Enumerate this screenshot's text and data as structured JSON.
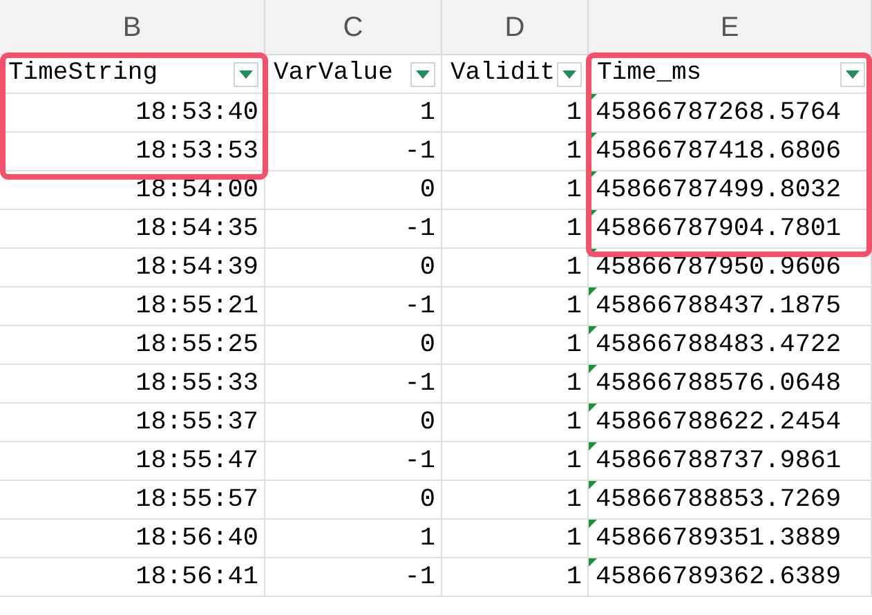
{
  "column_letters": [
    "B",
    "C",
    "D",
    "E"
  ],
  "header": [
    {
      "label": "TimeString",
      "boxed": true
    },
    {
      "label": "VarValue",
      "boxed": false
    },
    {
      "label": "Validit",
      "boxed": false
    },
    {
      "label": "Time_ms",
      "boxed": true
    }
  ],
  "rows": [
    {
      "time": "18:53:40",
      "value": "1",
      "validity": "1",
      "time_ms": "45866787268.5764",
      "time_boxed": true,
      "time_ms_boxed": true
    },
    {
      "time": "18:53:53",
      "value": "-1",
      "validity": "1",
      "time_ms": "45866787418.6806",
      "time_boxed": true,
      "time_ms_boxed": true
    },
    {
      "time": "18:54:00",
      "value": "0",
      "validity": "1",
      "time_ms": "45866787499.8032",
      "time_boxed": false,
      "time_ms_boxed": true
    },
    {
      "time": "18:54:35",
      "value": "-1",
      "validity": "1",
      "time_ms": "45866787904.7801",
      "time_boxed": false,
      "time_ms_boxed": true
    },
    {
      "time": "18:54:39",
      "value": "0",
      "validity": "1",
      "time_ms": "45866787950.9606",
      "time_boxed": false,
      "time_ms_boxed": false
    },
    {
      "time": "18:55:21",
      "value": "-1",
      "validity": "1",
      "time_ms": "45866788437.1875",
      "time_boxed": false,
      "time_ms_boxed": false
    },
    {
      "time": "18:55:25",
      "value": "0",
      "validity": "1",
      "time_ms": "45866788483.4722",
      "time_boxed": false,
      "time_ms_boxed": false
    },
    {
      "time": "18:55:33",
      "value": "-1",
      "validity": "1",
      "time_ms": "45866788576.0648",
      "time_boxed": false,
      "time_ms_boxed": false
    },
    {
      "time": "18:55:37",
      "value": "0",
      "validity": "1",
      "time_ms": "45866788622.2454",
      "time_boxed": false,
      "time_ms_boxed": false
    },
    {
      "time": "18:55:47",
      "value": "-1",
      "validity": "1",
      "time_ms": "45866788737.9861",
      "time_boxed": false,
      "time_ms_boxed": false
    },
    {
      "time": "18:55:57",
      "value": "0",
      "validity": "1",
      "time_ms": "45866788853.7269",
      "time_boxed": false,
      "time_ms_boxed": false
    },
    {
      "time": "18:56:40",
      "value": "1",
      "validity": "1",
      "time_ms": "45866789351.3889",
      "time_boxed": false,
      "time_ms_boxed": false
    },
    {
      "time": "18:56:41",
      "value": "-1",
      "validity": "1",
      "time_ms": "45866789362.6389",
      "time_boxed": false,
      "time_ms_boxed": false
    }
  ]
}
